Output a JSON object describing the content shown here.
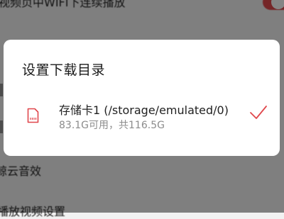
{
  "background": {
    "row1_text": "视频页中WIFI下连续播放",
    "row2_text": "鲸云音效",
    "row3_text": "播放视频设置"
  },
  "dialog": {
    "title": "设置下载目录",
    "option": {
      "name": "存储卡1 (/storage/emulated/0)",
      "detail": "83.1G可用，共116.5G",
      "selected": true
    }
  },
  "colors": {
    "accent": "#e0474c",
    "check": "#e0474c"
  },
  "icons": {
    "storage": "sd-card-icon",
    "selected": "check-icon"
  }
}
